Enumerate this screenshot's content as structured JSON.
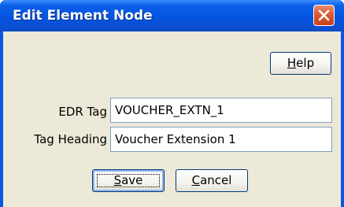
{
  "window": {
    "title": "Edit Element Node",
    "close_icon": "close-icon"
  },
  "buttons": {
    "help_label_mnemonic": "H",
    "help_label_rest": "elp",
    "save_label_mnemonic": "S",
    "save_label_rest": "ave",
    "cancel_label_mnemonic": "C",
    "cancel_label_rest": "ancel"
  },
  "form": {
    "edr_tag_label": "EDR Tag",
    "edr_tag_value": "VOUCHER_EXTN_1",
    "tag_heading_label": "Tag Heading",
    "tag_heading_value": "Voucher Extension 1"
  },
  "colors": {
    "titlebar": "#0554e0",
    "client_background": "#ece9d8",
    "close_button": "#dd5a33"
  }
}
